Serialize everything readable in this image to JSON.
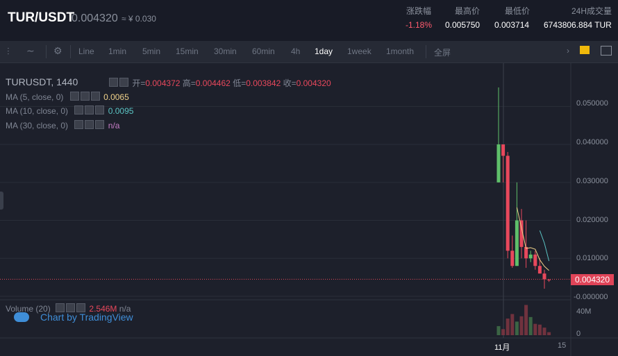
{
  "header": {
    "pair": "TUR/USDT",
    "price": "0.004320",
    "approx": "≈ ¥ 0.030",
    "stats": [
      {
        "label": "涨跌幅",
        "value": "-1.18%",
        "negative": true
      },
      {
        "label": "最高价",
        "value": "0.005750",
        "negative": false
      },
      {
        "label": "最低价",
        "value": "0.003714",
        "negative": false
      },
      {
        "label": "24H成交量",
        "value": "6743806.884 TUR",
        "negative": false
      }
    ]
  },
  "toolbar": {
    "intervals": [
      "Line",
      "1min",
      "5min",
      "15min",
      "30min",
      "60min",
      "4h",
      "1day",
      "1week",
      "1month"
    ],
    "active_interval": "1day",
    "fullscreen_label": "全屏"
  },
  "legend": {
    "symbol_line": "TURUSDT, 1440",
    "open_label": "开=",
    "open_value": "0.004372",
    "high_label": "高=",
    "high_value": "0.004462",
    "low_label": "低=",
    "low_value": "0.003842",
    "close_label": "收=",
    "close_value": "0.004320",
    "ma5_label": "MA (5, close, 0)",
    "ma5_value": "0.0065",
    "ma10_label": "MA (10, close, 0)",
    "ma10_value": "0.0095",
    "ma30_label": "MA (30, close, 0)",
    "ma30_value": "n/a",
    "volume_label": "Volume (20)",
    "volume_value": "2.546M",
    "volume_extra": "n/a"
  },
  "watermark": "Chart by TradingView",
  "axis": {
    "y_ticks": [
      "0.050000",
      "0.040000",
      "0.030000",
      "0.020000",
      "0.010000",
      "-0.000000"
    ],
    "current_price": "0.004320",
    "volume_ticks": [
      "40M",
      "0"
    ],
    "x_ticks": [
      "11月",
      "15"
    ]
  },
  "colors": {
    "up": "#5fbf6a",
    "down": "#e8485c",
    "ma5": "#f0d28a",
    "ma10": "#5bc4c4",
    "ma30": "#c77dc7"
  },
  "chart_data": {
    "type": "candlestick",
    "ylim": [
      0,
      0.055
    ],
    "candles": [
      {
        "o": 0.03,
        "h": 0.055,
        "l": 0.03,
        "c": 0.04
      },
      {
        "o": 0.04,
        "h": 0.04,
        "l": 0.03,
        "c": 0.037
      },
      {
        "o": 0.037,
        "h": 0.038,
        "l": 0.01,
        "c": 0.012
      },
      {
        "o": 0.012,
        "h": 0.016,
        "l": 0.0075,
        "c": 0.008
      },
      {
        "o": 0.008,
        "h": 0.03,
        "l": 0.008,
        "c": 0.02
      },
      {
        "o": 0.02,
        "h": 0.023,
        "l": 0.01,
        "c": 0.013
      },
      {
        "o": 0.013,
        "h": 0.02,
        "l": 0.0075,
        "c": 0.01
      },
      {
        "o": 0.01,
        "h": 0.012,
        "l": 0.009,
        "c": 0.011
      },
      {
        "o": 0.011,
        "h": 0.012,
        "l": 0.007,
        "c": 0.008
      },
      {
        "o": 0.008,
        "h": 0.01,
        "l": 0.006,
        "c": 0.006
      },
      {
        "o": 0.006,
        "h": 0.007,
        "l": 0.002,
        "c": 0.0045
      },
      {
        "o": 0.0044,
        "h": 0.0045,
        "l": 0.0038,
        "c": 0.0043
      }
    ],
    "volumes": [
      12,
      8,
      22,
      28,
      18,
      25,
      40,
      24,
      15,
      14,
      10,
      4
    ],
    "volume_max": 45,
    "ma5": [
      null,
      null,
      null,
      null,
      0.0234,
      0.018,
      0.0126,
      0.0128,
      0.0124,
      0.0096,
      0.0079,
      0.0068
    ],
    "ma10": [
      null,
      null,
      null,
      null,
      null,
      null,
      null,
      null,
      null,
      0.0173,
      0.014,
      0.0093
    ]
  }
}
